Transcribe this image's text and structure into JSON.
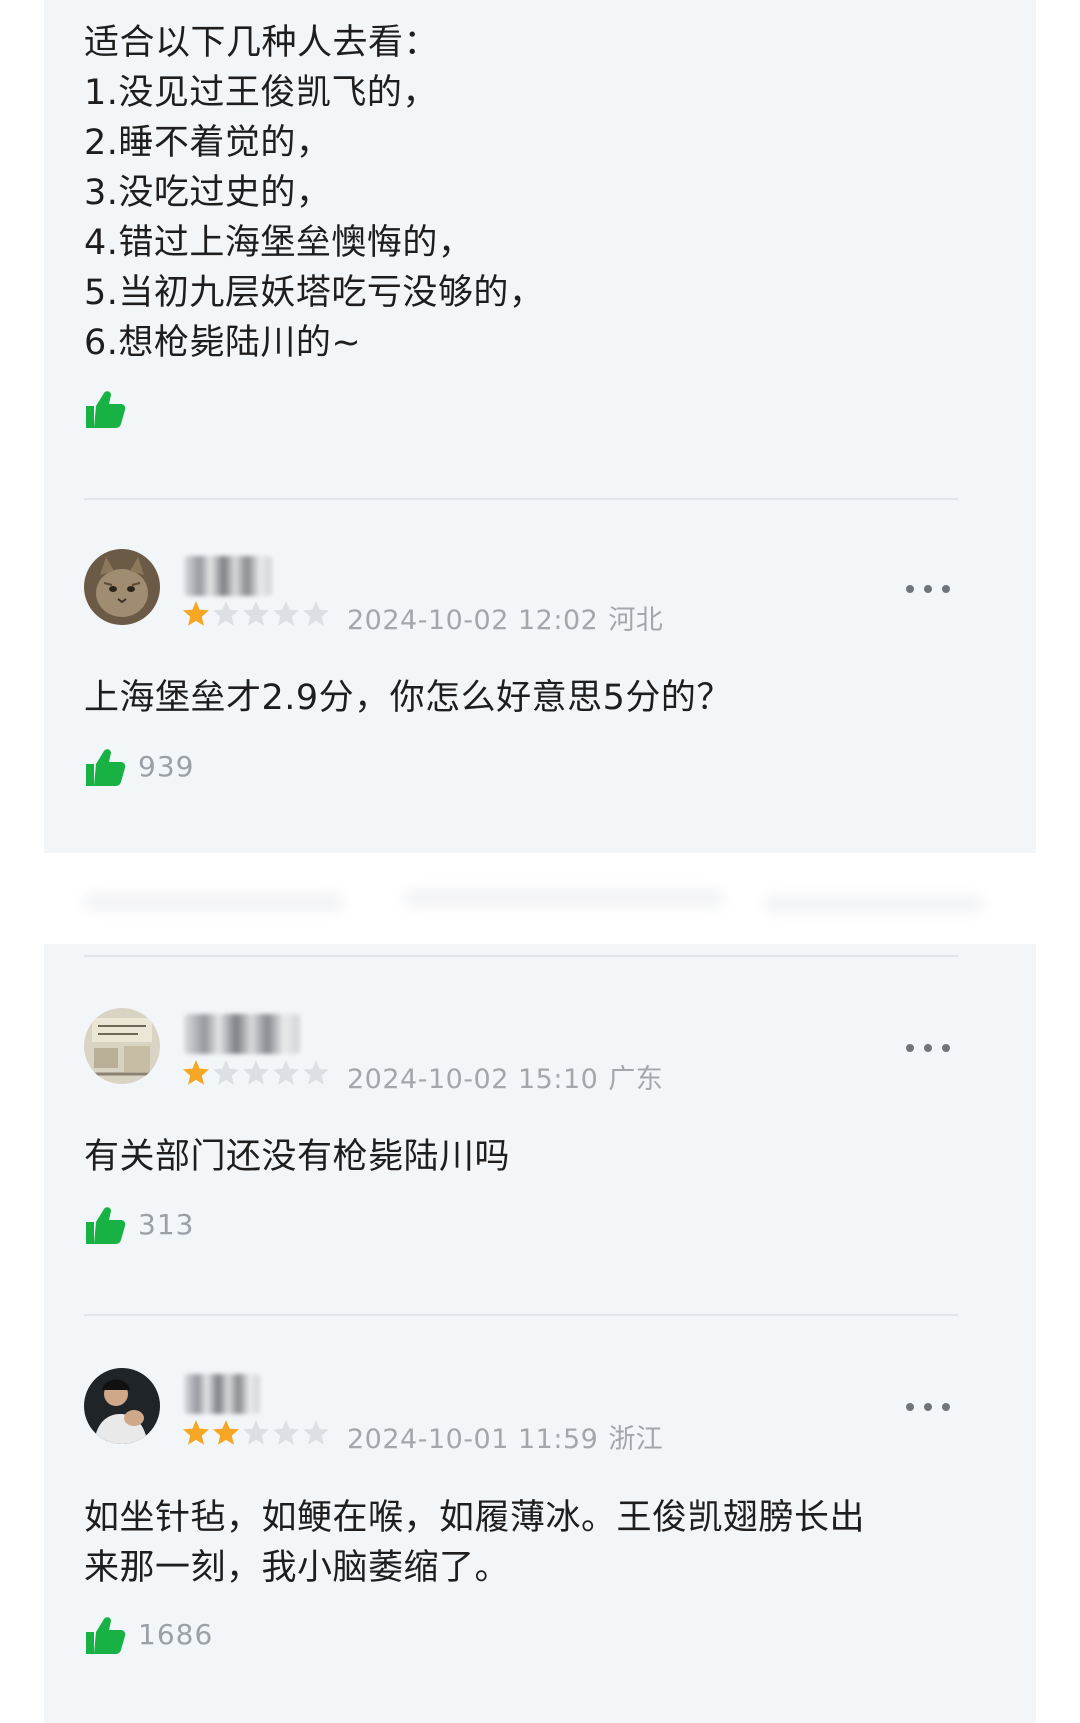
{
  "intro_post": {
    "lines": [
      "适合以下几种人去看：",
      "1.没见过王俊凯飞的，",
      "2.睡不着觉的，",
      "3.没吃过史的，",
      "4.错过上海堡垒懊悔的，",
      "5.当初九层妖塔吃亏没够的，",
      "6.想枪毙陆川的~"
    ],
    "like_icon": "thumbs-up-icon"
  },
  "reviews": [
    {
      "avatar": "cat-photo-avatar",
      "rating_stars": 1,
      "rating_max": 5,
      "date": "2024-10-02 12:02",
      "region": "河北",
      "text": "上海堡垒才2.9分，你怎么好意思5分的？",
      "likes": "939",
      "more_icon": "more-dots-icon"
    },
    {
      "avatar": "sketch-photo-avatar",
      "rating_stars": 1,
      "rating_max": 5,
      "date": "2024-10-02 15:10",
      "region": "广东",
      "text": "有关部门还没有枪毙陆川吗",
      "likes": "313",
      "more_icon": "more-dots-icon"
    },
    {
      "avatar": "person-photo-avatar",
      "rating_stars": 2,
      "rating_max": 5,
      "date": "2024-10-01 11:59",
      "region": "浙江",
      "text_lines": [
        "如坐针毡，如鲠在喉，如履薄冰。王俊凯翅膀长出",
        "来那一刻，我小脑萎缩了。"
      ],
      "likes": "1686",
      "more_icon": "more-dots-icon"
    }
  ],
  "colors": {
    "panel_bg": "#f3f6f9",
    "like_green": "#18b244",
    "star_filled": "#f5a623",
    "star_empty": "#dcdfe3",
    "meta_gray": "#a3a7ab"
  }
}
